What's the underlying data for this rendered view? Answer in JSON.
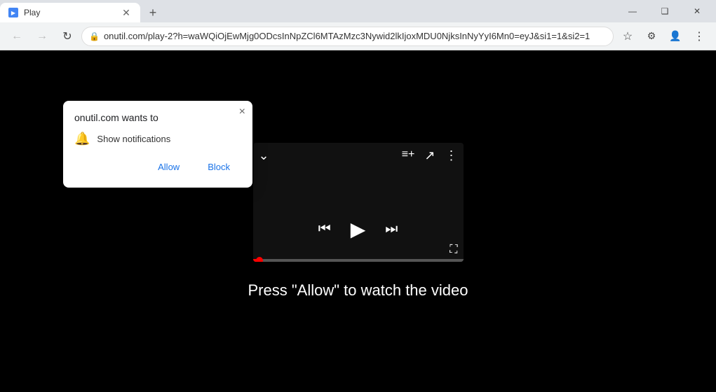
{
  "browser": {
    "tab": {
      "label": "Play",
      "favicon": "▶"
    },
    "new_tab_icon": "+",
    "window_controls": {
      "minimize": "—",
      "maximize": "❑",
      "close": "✕"
    },
    "toolbar": {
      "back": "←",
      "forward": "→",
      "reload": "↻",
      "lock_icon": "🔒",
      "address": "onutil.com/play-2?h=waWQiOjEwMjg0ODcsInNpZCl6MTAzMzc3Nywid2lkIjoxMDU0NjksInNyYyI6Mn0=eyJ&si1=1&si2=1",
      "star_icon": "☆",
      "extensions_icon": "⚙",
      "profile_icon": "👤",
      "menu_icon": "⋮"
    }
  },
  "notification_popup": {
    "title": "onutil.com wants to",
    "close_icon": "×",
    "bell_icon": "🔔",
    "row_text": "Show notifications",
    "allow_label": "Allow",
    "block_label": "Block"
  },
  "video_player": {
    "chevron_down": "⌄",
    "add_to_queue": "≡+",
    "share": "↗",
    "more": "⋮",
    "skip_back": "⏮",
    "play": "▶",
    "skip_forward": "⏭",
    "fullscreen": "⛶",
    "progress_percent": 3
  },
  "page": {
    "instruction_text": "Press \"Allow\" to watch the video",
    "background_color": "#000000"
  }
}
